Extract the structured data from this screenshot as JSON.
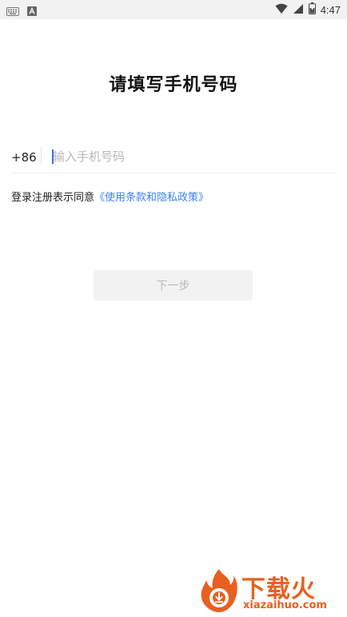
{
  "status_bar": {
    "left_icons": [
      "keyboard-icon",
      "a-icon"
    ],
    "right_icons": [
      "wifi-icon",
      "signal-icon",
      "battery-icon"
    ],
    "time": "4:47"
  },
  "page": {
    "title": "请填写手机号码"
  },
  "phone": {
    "country_code": "+86",
    "placeholder": "输入手机号码",
    "value": ""
  },
  "agreement": {
    "prefix": "登录注册表示同意",
    "link": "《使用条款和隐私政策》"
  },
  "next_button": {
    "label": "下一步",
    "enabled": false
  },
  "watermark": {
    "title": "下载火",
    "url": "xiazaihuo.com"
  },
  "colors": {
    "accent": "#3b82f6",
    "caret": "#3b6de8",
    "button_bg": "#f2f2f2",
    "button_text": "#b8b8b8",
    "watermark": "#e8601f"
  }
}
